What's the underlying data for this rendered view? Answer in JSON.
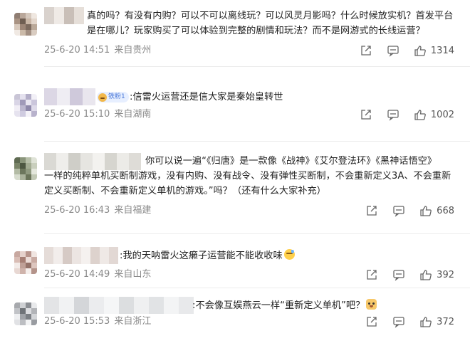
{
  "comments": [
    {
      "text": "真的吗？有没有内购？可以不可以离线玩？可以风灵月影吗？什么时候放实机？首发平台\n是在哪儿？玩家购买了可以体验到完整的剧情和玩法？而不是网游式的长线运营？",
      "time": "25-6-20 14:51",
      "location": "来自贵州",
      "likes": "1314"
    },
    {
      "badge": "铁粉1",
      "text": ":信雷火运营还是信大家是秦始皇转世",
      "time": "25-6-20 15:10",
      "location": "来自湖南",
      "likes": "1002"
    },
    {
      "text": "你可以说一遍“《归唐》是一款像《战神》《艾尔登法环》《黑神话悟空》\n一样的纯粹单机买断制游戏，没有内购、没有战令、没有弹性买断制，不会重新定义3A、不会重新\n定义买断制、不会重新定义单机的游戏。”吗？（还有什么大家补充）",
      "time": "25-6-20 16:43",
      "location": "来自福建",
      "likes": "668"
    },
    {
      "text": ":我的天呐雷火这癞子运营能不能收收味",
      "emoji": "sweat-emoji",
      "time": "25-6-20 14:49",
      "location": "来自山东",
      "likes": "392"
    },
    {
      "text": ":不会像互娱燕云一样“重新定义单机”吧？",
      "emoji": "dog-emoji",
      "time": "25-6-20 15:53",
      "location": "来自浙江",
      "likes": "372"
    }
  ],
  "icons": {
    "share": "share-icon",
    "comment": "comment-icon",
    "like": "thumbs-up-icon"
  },
  "colors": {
    "meta_text": "#8a8a8a",
    "badge_bg": "#e7efff",
    "badge_text": "#4a78d9",
    "icon_stroke": "#666666"
  }
}
